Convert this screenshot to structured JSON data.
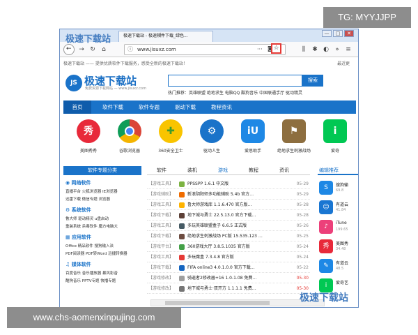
{
  "watermarks": {
    "tag": "TG: MYYJJPP",
    "url": "www.chs-aomenxinpujing.com",
    "logo_top": "极速下载站",
    "logo_bottom": "极速下载站"
  },
  "browser": {
    "tab_title": "极速下载站 - 极速软件下载_绿色...",
    "url": "www.jisuxz.com",
    "url_more": "···",
    "new_tab": "+",
    "win_min": "—",
    "win_max": "□",
    "win_close": "✕"
  },
  "page": {
    "top_notice": "极速下载站 —— 提供优质软件下载服务，感受全新的极速下载站！",
    "top_right": "最近更",
    "logo_badge": "JS",
    "logo_text": "极速下载站",
    "logo_sub": "免费资源下载网站 — www.jisuxz.com",
    "search_button": "搜索",
    "hot_line": "热门推荐：英雄联盟  绝地求生  电脑QQ  酷狗音乐  中国联通手厅  驱动精灵",
    "menu": [
      "首页",
      "软件下载",
      "软件专题",
      "驱动下载",
      "教程资讯"
    ],
    "apps": [
      {
        "label": "美图秀秀",
        "glyph": "秀",
        "color": "#e8293a"
      },
      {
        "label": "谷歌浏览器",
        "glyph": "◉",
        "color": "#4caf50"
      },
      {
        "label": "360安全卫士",
        "glyph": "✚",
        "color": "#7cc242"
      },
      {
        "label": "驱动人生",
        "glyph": "⚙",
        "color": "#1a73c9"
      },
      {
        "label": "爱思助手",
        "glyph": "iU",
        "color": "#1e88e5"
      },
      {
        "label": "绝地求生刺激战场",
        "glyph": "⚑",
        "color": "#8d6e3f"
      },
      {
        "label": "爱奇",
        "glyph": "i",
        "color": "#00c853"
      }
    ],
    "category_header": "软件专题分类",
    "categories": [
      {
        "title": "网络软件",
        "rows": [
          "直播平台   火狐浏览器   IE浏览器",
          "迅雷下载   微信专题   浏览器"
        ]
      },
      {
        "title": "系统软件",
        "rows": [
          "鲁大师   驱动精灵   u盘启动",
          "重装系统   杀毒软件   魔方电脑大"
        ]
      },
      {
        "title": "应用软件",
        "rows": [
          "Office   精品软件   搜狗输入法",
          "PDF阅读器   PDF转Word   迅捷转换器"
        ]
      },
      {
        "title": "媒体软件",
        "rows": [
          "百度音乐   音乐播放器   暴风影音",
          "酷狗音乐   PPTV专题   快播专题"
        ]
      }
    ],
    "content_tabs": [
      "软件",
      "装机",
      "游戏",
      "教程",
      "资讯"
    ],
    "content_rows": [
      {
        "tag": "【游戏工具】",
        "name": "PPSSPP 1.6.1 中文版",
        "date": "05-29",
        "icon": "#7cb342",
        "red": false
      },
      {
        "tag": "【游戏辅助】",
        "name": "新浪阴阳师多功能辅助 5.4b 官方…",
        "date": "05-29",
        "icon": "#ef6c00",
        "red": false
      },
      {
        "tag": "【游戏工具】",
        "name": "鲁大师游戏库 1.1.6.470 官方版…",
        "date": "05-28",
        "icon": "#ffb300",
        "red": false
      },
      {
        "tag": "【游戏下载】",
        "name": "地下城与勇士 22.5.13.0 官方下载…",
        "date": "05-28",
        "icon": "#5d4037",
        "red": false
      },
      {
        "tag": "【游戏工具】",
        "name": "多玩英雄联盟盒子 6.6.5 正式版",
        "date": "05-26",
        "icon": "#455a64",
        "red": false
      },
      {
        "tag": "【游戏下载】",
        "name": "绝地求生刺激战场 PC版 15.535.123 …",
        "date": "05-25",
        "icon": "#6d4c41",
        "red": false
      },
      {
        "tag": "【游戏平台】",
        "name": "360游戏大厅 3.8.5.1035 官方版",
        "date": "05-24",
        "icon": "#43a047",
        "red": false
      },
      {
        "tag": "【游戏工具】",
        "name": "多玩魔盒 7.3.4.8 官方版",
        "date": "05-24",
        "icon": "#e53935",
        "red": false
      },
      {
        "tag": "【游戏下载】",
        "name": "FIFA online3 4.0.1.0.0 官方下载…",
        "date": "05-22",
        "icon": "#1565c0",
        "red": false
      },
      {
        "tag": "【游戏修改】",
        "name": "骑逍者2修改器+16 1.0-1.08 免费…",
        "date": "05-30",
        "icon": "#9e9e9e",
        "red": true
      },
      {
        "tag": "【游戏修改】",
        "name": "地下城与勇士·双开方 1.1.1.1 免费…",
        "date": "05-30",
        "icon": "#757575",
        "red": true
      }
    ],
    "editor_header": "编辑推荐",
    "editor_items": [
      {
        "name": "搜狗输",
        "size": "69.8",
        "glyph": "S",
        "color": "#1e88e5"
      },
      {
        "name": "有道云",
        "size": "41.84",
        "glyph": "☺",
        "color": "#1976d2"
      },
      {
        "name": "iTune",
        "size": "199.65",
        "glyph": "♪",
        "color": "#ec407a"
      },
      {
        "name": "美图秀",
        "size": "34.48",
        "glyph": "秀",
        "color": "#e8293a"
      },
      {
        "name": "有道云",
        "size": "48.5",
        "glyph": "✎",
        "color": "#1e88e5"
      },
      {
        "name": "爱奇艺",
        "size": "",
        "glyph": "i",
        "color": "#00c853"
      }
    ]
  }
}
